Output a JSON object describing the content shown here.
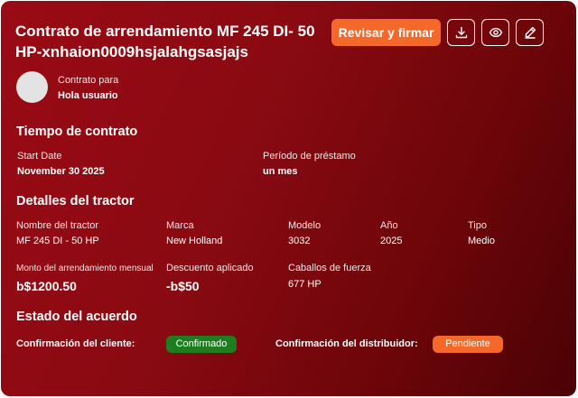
{
  "header": {
    "title": "Contrato de arrendamiento MF 245 DI- 50 HP-xnhaion0009hsjalahgsasjajs",
    "review_sign_label": "Revisar y firmar"
  },
  "icons": {
    "download": "download-icon",
    "view": "eye-icon",
    "edit": "pencil-icon"
  },
  "contract_for": {
    "label": "Contrato para",
    "name": "Hola usuario"
  },
  "contract_time": {
    "heading": "Tiempo de contrato",
    "start_label": "Start Date",
    "start_value": "November 30  2025",
    "period_label": "Período de préstamo",
    "period_value": "un mes"
  },
  "tractor": {
    "heading": "Detalles del tractor",
    "name_label": "Nombre del tractor",
    "name_value": "MF 245 DI - 50 HP",
    "brand_label": "Marca",
    "brand_value": "New Holland",
    "model_label": "Modelo",
    "model_value": "3032",
    "year_label": "Año",
    "year_value": "2025",
    "type_label": "Tipo",
    "type_value": "Medio",
    "amount_label": "Monto del arrendamiento mensual",
    "amount_value": "b$1200.50",
    "discount_label": "Descuento aplicado",
    "discount_value": "-b$50",
    "hp_label": "Caballos de fuerza",
    "hp_value": "677 HP"
  },
  "agreement": {
    "heading": "Estado del acuerdo",
    "client_label": "Confirmación del cliente:",
    "client_status": "Confirmado",
    "dealer_label": "Confirmación del distribuidor:",
    "dealer_status": "Pendiente"
  },
  "colors": {
    "accent": "#f4682a",
    "success": "#1e7d1e",
    "card_start": "#9a0a14",
    "card_end": "#4a0204"
  }
}
